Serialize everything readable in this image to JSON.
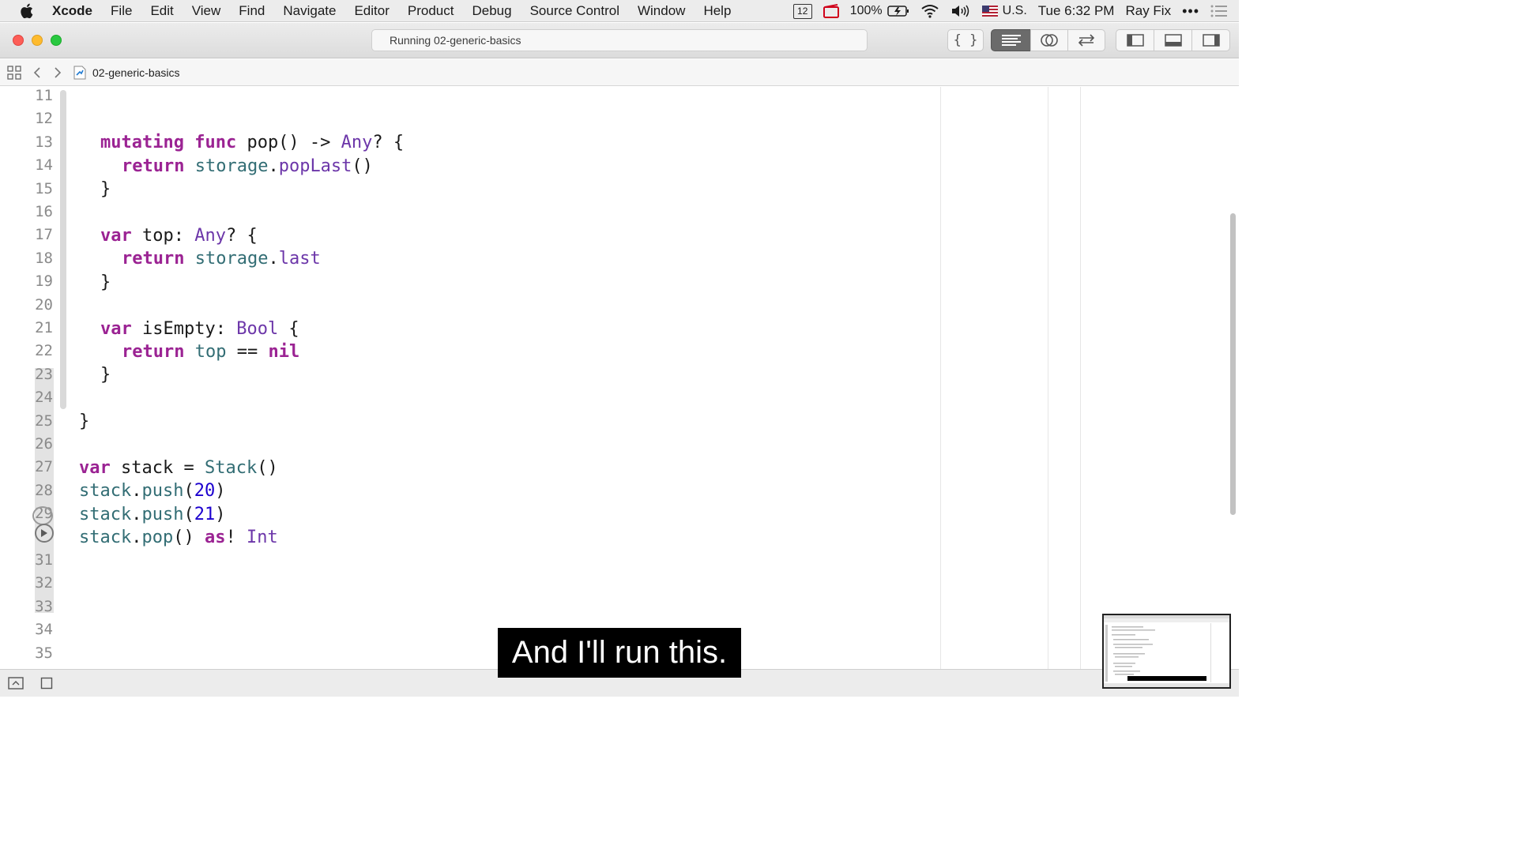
{
  "menubar": {
    "items": [
      "Xcode",
      "File",
      "Edit",
      "View",
      "Find",
      "Navigate",
      "Editor",
      "Product",
      "Debug",
      "Source Control",
      "Window",
      "Help"
    ],
    "status": {
      "calendar_day": "12",
      "battery": "100%",
      "input_source": "U.S.",
      "clock": "Tue 6:32 PM",
      "user": "Ray Fix"
    }
  },
  "titlebar": {
    "activity": "Running 02-generic-basics"
  },
  "jumpbar": {
    "file": "02-generic-basics"
  },
  "editor": {
    "line_numbers": [
      "11",
      "12",
      "13",
      "14",
      "15",
      "16",
      "17",
      "18",
      "19",
      "20",
      "21",
      "22",
      "23",
      "24",
      "25",
      "26",
      "27",
      "28",
      "29",
      "",
      "31",
      "32",
      "33",
      "34",
      "35"
    ],
    "lines": [
      {
        "n": "12",
        "tokens": [
          [
            "kw",
            "mutating"
          ],
          [
            "pl",
            " "
          ],
          [
            "kw",
            "func"
          ],
          [
            "pl",
            " pop() -> "
          ],
          [
            "ty",
            "Any"
          ],
          [
            "pl",
            "? {"
          ]
        ],
        "indent": 1
      },
      {
        "n": "13",
        "tokens": [
          [
            "kw",
            "return"
          ],
          [
            "pl",
            " "
          ],
          [
            "id",
            "storage"
          ],
          [
            "pl",
            "."
          ],
          [
            "ty",
            "popLast"
          ],
          [
            "pl",
            "()"
          ]
        ],
        "indent": 2
      },
      {
        "n": "14",
        "tokens": [
          [
            "pl",
            "}"
          ]
        ],
        "indent": 1
      },
      {
        "n": "16",
        "tokens": [
          [
            "kw",
            "var"
          ],
          [
            "pl",
            " top: "
          ],
          [
            "ty",
            "Any"
          ],
          [
            "pl",
            "? {"
          ]
        ],
        "indent": 1
      },
      {
        "n": "17",
        "tokens": [
          [
            "kw",
            "return"
          ],
          [
            "pl",
            " "
          ],
          [
            "id",
            "storage"
          ],
          [
            "pl",
            "."
          ],
          [
            "ty",
            "last"
          ]
        ],
        "indent": 2
      },
      {
        "n": "18",
        "tokens": [
          [
            "pl",
            "}"
          ]
        ],
        "indent": 1
      },
      {
        "n": "20",
        "tokens": [
          [
            "kw",
            "var"
          ],
          [
            "pl",
            " isEmpty: "
          ],
          [
            "ty",
            "Bool"
          ],
          [
            "pl",
            " {"
          ]
        ],
        "indent": 1
      },
      {
        "n": "21",
        "tokens": [
          [
            "kw",
            "return"
          ],
          [
            "pl",
            " "
          ],
          [
            "id",
            "top"
          ],
          [
            "pl",
            " == "
          ],
          [
            "kw",
            "nil"
          ]
        ],
        "indent": 2
      },
      {
        "n": "22",
        "tokens": [
          [
            "pl",
            "}"
          ]
        ],
        "indent": 1
      },
      {
        "n": "24",
        "tokens": [
          [
            "pl",
            "}"
          ]
        ],
        "indent": 0
      },
      {
        "n": "26",
        "tokens": [
          [
            "kw",
            "var"
          ],
          [
            "pl",
            " stack = "
          ],
          [
            "id",
            "Stack"
          ],
          [
            "pl",
            "()"
          ]
        ],
        "indent": 0
      },
      {
        "n": "27",
        "tokens": [
          [
            "id",
            "stack"
          ],
          [
            "pl",
            "."
          ],
          [
            "id",
            "push"
          ],
          [
            "pl",
            "("
          ],
          [
            "num",
            "20"
          ],
          [
            "pl",
            ")"
          ]
        ],
        "indent": 0
      },
      {
        "n": "28",
        "tokens": [
          [
            "id",
            "stack"
          ],
          [
            "pl",
            "."
          ],
          [
            "id",
            "push"
          ],
          [
            "pl",
            "("
          ],
          [
            "num",
            "21"
          ],
          [
            "pl",
            ")"
          ]
        ],
        "indent": 0
      },
      {
        "n": "29",
        "tokens": [
          [
            "id",
            "stack"
          ],
          [
            "pl",
            "."
          ],
          [
            "id",
            "pop"
          ],
          [
            "pl",
            "() "
          ],
          [
            "kw",
            "as"
          ],
          [
            "pl",
            "! "
          ],
          [
            "ty",
            "Int"
          ]
        ],
        "indent": 0
      }
    ]
  },
  "caption": "And I'll run this.",
  "colors": {
    "keyword": "#9b2393",
    "type": "#6c36a9",
    "identifier": "#326d74",
    "number": "#1c00cf"
  }
}
